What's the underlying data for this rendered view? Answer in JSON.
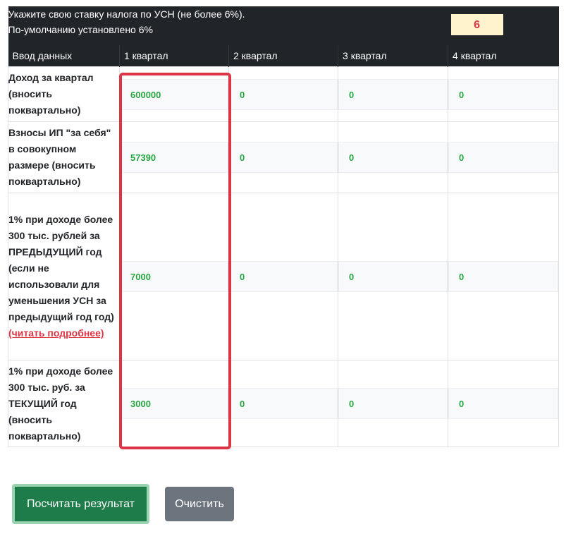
{
  "header": {
    "note_line1": "Укажите свою ставку налога по УСН (не более 6%).",
    "note_line2": "По-умолчанию установлено 6%",
    "tax_rate": "6"
  },
  "columns": [
    "Ввод данных",
    "1 квартал",
    "2 квартал",
    "3 квартал",
    "4 квартал"
  ],
  "rows": [
    {
      "label": "Доход за квартал (вносить поквартально)",
      "values": [
        "600000",
        "0",
        "0",
        "0"
      ]
    },
    {
      "label": "Взносы ИП \"за себя\" в совокупном размере (вносить поквартально)",
      "values": [
        "57390",
        "0",
        "0",
        "0"
      ]
    },
    {
      "label": "1% при доходе более 300 тыс. рублей за ПРЕДЫДУЩИЙ год (если не использовали для уменьшения УСН за предыдущий год год)",
      "link": "(читать подробнее)",
      "values": [
        "7000",
        "0",
        "0",
        "0"
      ]
    },
    {
      "label": "1% при доходе более 300 тыс. руб. за ТЕКУЩИЙ год (вносить поквартально)",
      "values": [
        "3000",
        "0",
        "0",
        "0"
      ]
    }
  ],
  "buttons": {
    "calculate": "Посчитать результат",
    "clear": "Очистить"
  },
  "colors": {
    "header_bg": "#212529",
    "value_text": "#28a745",
    "rate_text": "#dc3545",
    "rate_bg": "#fff3cd",
    "highlight_border": "#dc3545",
    "calc_button": "#1e7b4a",
    "clear_button": "#6c757d"
  }
}
